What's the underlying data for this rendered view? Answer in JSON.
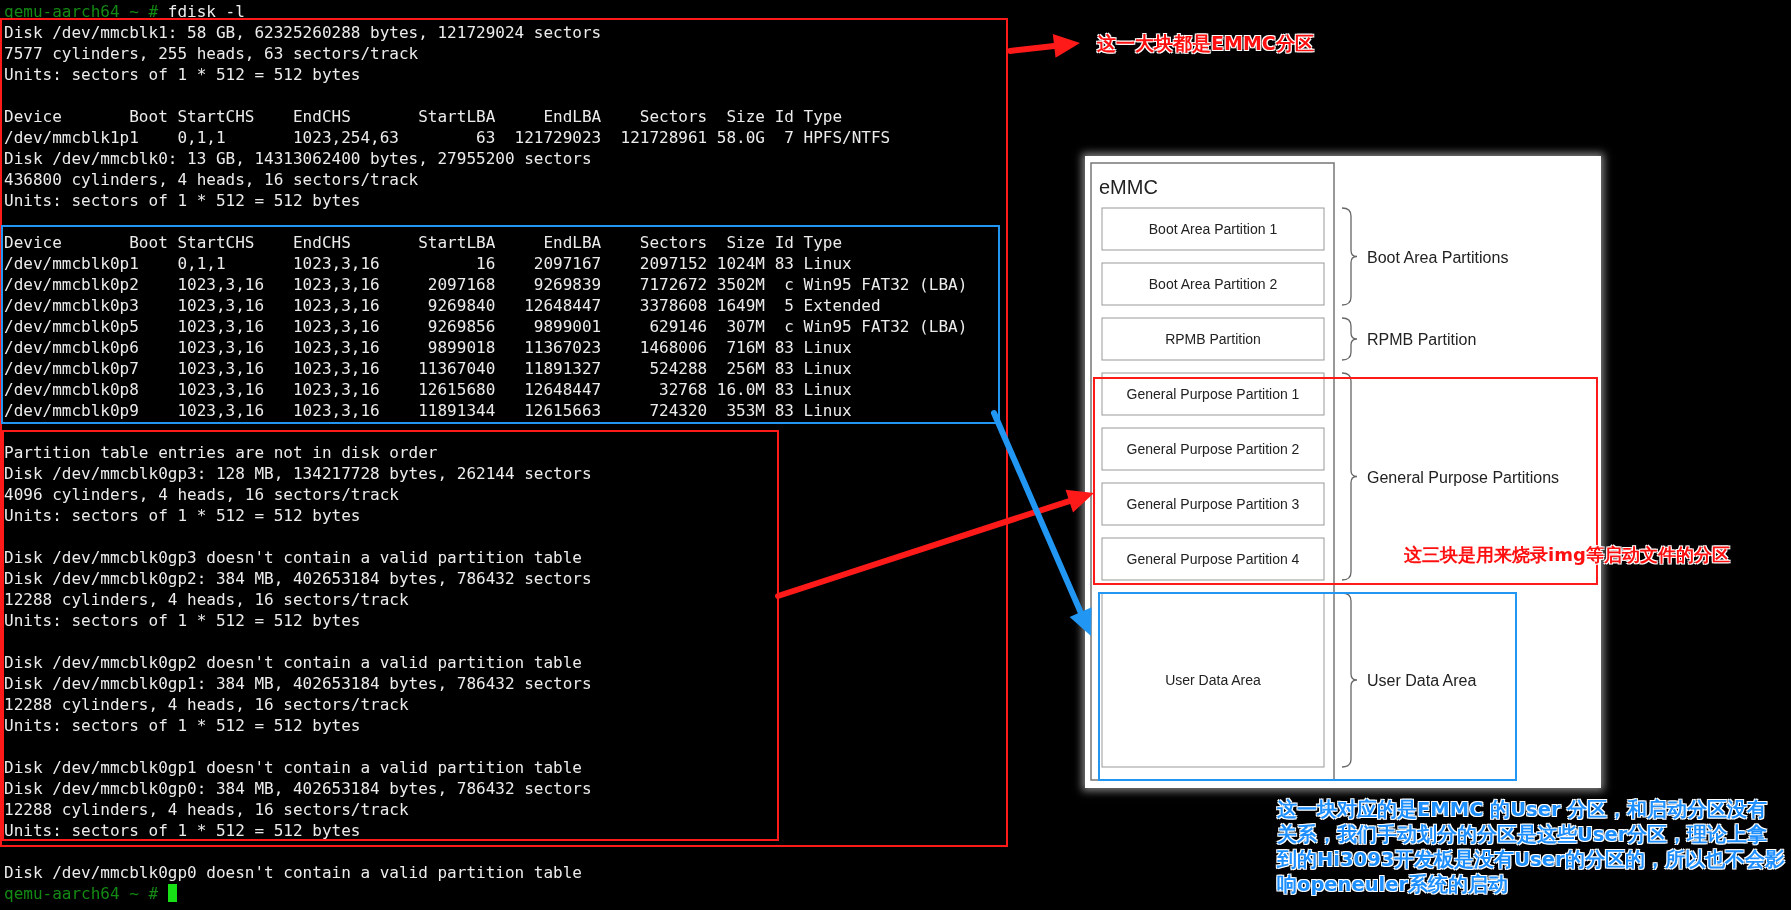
{
  "terminal": {
    "lines": [
      {
        "kind": "prompt",
        "prompt": "qemu-aarch64 ~ #",
        "command": "fdisk -l"
      },
      {
        "kind": "output",
        "text": "Disk /dev/mmcblk1: 58 GB, 62325260288 bytes, 121729024 sectors"
      },
      {
        "kind": "output",
        "text": "7577 cylinders, 255 heads, 63 sectors/track"
      },
      {
        "kind": "output",
        "text": "Units: sectors of 1 * 512 = 512 bytes"
      },
      {
        "kind": "blank"
      },
      {
        "kind": "output",
        "text": "Device       Boot StartCHS    EndCHS       StartLBA     EndLBA    Sectors  Size Id Type"
      },
      {
        "kind": "output",
        "text": "/dev/mmcblk1p1    0,1,1       1023,254,63        63  121729023  121728961 58.0G  7 HPFS/NTFS"
      },
      {
        "kind": "output",
        "text": "Disk /dev/mmcblk0: 13 GB, 14313062400 bytes, 27955200 sectors"
      },
      {
        "kind": "output",
        "text": "436800 cylinders, 4 heads, 16 sectors/track"
      },
      {
        "kind": "output",
        "text": "Units: sectors of 1 * 512 = 512 bytes"
      },
      {
        "kind": "blank"
      },
      {
        "kind": "output",
        "text": "Device       Boot StartCHS    EndCHS       StartLBA     EndLBA    Sectors  Size Id Type"
      },
      {
        "kind": "output",
        "text": "/dev/mmcblk0p1    0,1,1       1023,3,16          16    2097167    2097152 1024M 83 Linux"
      },
      {
        "kind": "output",
        "text": "/dev/mmcblk0p2    1023,3,16   1023,3,16     2097168    9269839    7172672 3502M  c Win95 FAT32 (LBA)"
      },
      {
        "kind": "output",
        "text": "/dev/mmcblk0p3    1023,3,16   1023,3,16     9269840   12648447    3378608 1649M  5 Extended"
      },
      {
        "kind": "output",
        "text": "/dev/mmcblk0p5    1023,3,16   1023,3,16     9269856    9899001     629146  307M  c Win95 FAT32 (LBA)"
      },
      {
        "kind": "output",
        "text": "/dev/mmcblk0p6    1023,3,16   1023,3,16     9899018   11367023    1468006  716M 83 Linux"
      },
      {
        "kind": "output",
        "text": "/dev/mmcblk0p7    1023,3,16   1023,3,16    11367040   11891327     524288  256M 83 Linux"
      },
      {
        "kind": "output",
        "text": "/dev/mmcblk0p8    1023,3,16   1023,3,16    12615680   12648447      32768 16.0M 83 Linux"
      },
      {
        "kind": "output",
        "text": "/dev/mmcblk0p9    1023,3,16   1023,3,16    11891344   12615663     724320  353M 83 Linux"
      },
      {
        "kind": "blank"
      },
      {
        "kind": "output",
        "text": "Partition table entries are not in disk order"
      },
      {
        "kind": "output",
        "text": "Disk /dev/mmcblk0gp3: 128 MB, 134217728 bytes, 262144 sectors"
      },
      {
        "kind": "output",
        "text": "4096 cylinders, 4 heads, 16 sectors/track"
      },
      {
        "kind": "output",
        "text": "Units: sectors of 1 * 512 = 512 bytes"
      },
      {
        "kind": "blank"
      },
      {
        "kind": "output",
        "text": "Disk /dev/mmcblk0gp3 doesn't contain a valid partition table"
      },
      {
        "kind": "output",
        "text": "Disk /dev/mmcblk0gp2: 384 MB, 402653184 bytes, 786432 sectors"
      },
      {
        "kind": "output",
        "text": "12288 cylinders, 4 heads, 16 sectors/track"
      },
      {
        "kind": "output",
        "text": "Units: sectors of 1 * 512 = 512 bytes"
      },
      {
        "kind": "blank"
      },
      {
        "kind": "output",
        "text": "Disk /dev/mmcblk0gp2 doesn't contain a valid partition table"
      },
      {
        "kind": "output",
        "text": "Disk /dev/mmcblk0gp1: 384 MB, 402653184 bytes, 786432 sectors"
      },
      {
        "kind": "output",
        "text": "12288 cylinders, 4 heads, 16 sectors/track"
      },
      {
        "kind": "output",
        "text": "Units: sectors of 1 * 512 = 512 bytes"
      },
      {
        "kind": "blank"
      },
      {
        "kind": "output",
        "text": "Disk /dev/mmcblk0gp1 doesn't contain a valid partition table"
      },
      {
        "kind": "output",
        "text": "Disk /dev/mmcblk0gp0: 384 MB, 402653184 bytes, 786432 sectors"
      },
      {
        "kind": "output",
        "text": "12288 cylinders, 4 heads, 16 sectors/track"
      },
      {
        "kind": "output",
        "text": "Units: sectors of 1 * 512 = 512 bytes"
      },
      {
        "kind": "blank"
      },
      {
        "kind": "output",
        "text": "Disk /dev/mmcblk0gp0 doesn't contain a valid partition table"
      },
      {
        "kind": "prompt",
        "prompt": "qemu-aarch64 ~ #",
        "cursor": true
      }
    ]
  },
  "diagram": {
    "title": "eMMC",
    "groups": [
      {
        "label": "Boot Area Partitions",
        "kind": "block",
        "partitions": [
          "Boot Area Partition 1",
          "Boot Area Partition 2"
        ]
      },
      {
        "label": "RPMB Partition",
        "kind": "block",
        "partitions": [
          "RPMB Partition"
        ]
      },
      {
        "label": "General Purpose Partitions",
        "kind": "block",
        "partitions": [
          "General Purpose Partition 1",
          "General Purpose Partition 2",
          "General Purpose Partition 3",
          "General Purpose Partition 4"
        ]
      },
      {
        "label": "User Data Area",
        "kind": "data",
        "partitions": [
          "User Data Area"
        ]
      }
    ]
  },
  "annotations": [
    {
      "kind": "top",
      "color": "#ff1010",
      "text": "这一大块都是EMMC分区"
    },
    {
      "kind": "right",
      "color": "#ff1010",
      "text": "这三块是用来烧录img等启动文件的分区"
    },
    {
      "kind": "bottom",
      "color": "#1e8fff",
      "text": "这一块对应的是EMMC 的User 分区，和启动分区没有关系，我们手动划分的分区是这些User分区，理论上拿到的Hi3093开发板是没有User的分区的，所以也不会影响openeuler系统的启动"
    }
  ]
}
